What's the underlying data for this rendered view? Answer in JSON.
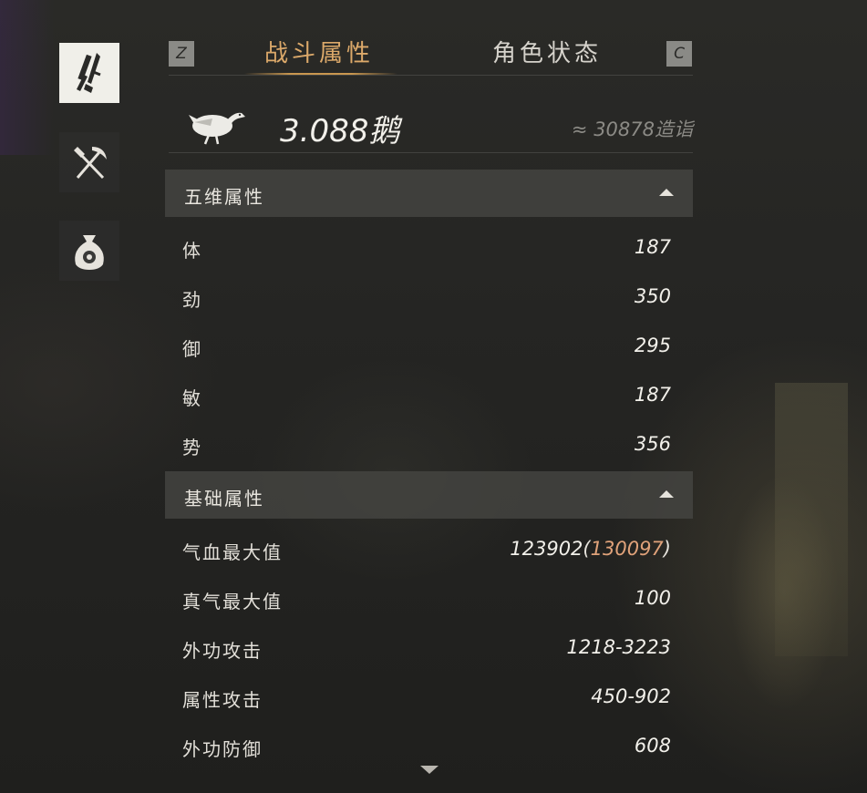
{
  "tabs": {
    "left_key": "Z",
    "right_key": "C",
    "active_label": "战斗属性",
    "inactive_label": "角色状态"
  },
  "sidebar": {
    "items": [
      {
        "icon": "weapons-icon",
        "active": true
      },
      {
        "icon": "shovel-pickaxe-icon",
        "active": false
      },
      {
        "icon": "money-bag-icon",
        "active": false
      }
    ]
  },
  "power": {
    "icon": "goose-icon",
    "value": "3.088鹅",
    "approx": "≈ 30878造诣"
  },
  "sections": {
    "five_dim": {
      "title": "五维属性",
      "rows": [
        {
          "label": "体",
          "value": "187"
        },
        {
          "label": "劲",
          "value": "350"
        },
        {
          "label": "御",
          "value": "295"
        },
        {
          "label": "敏",
          "value": "187"
        },
        {
          "label": "势",
          "value": "356"
        }
      ]
    },
    "basic": {
      "title": "基础属性",
      "hp": {
        "label": "气血最大值",
        "base": "123902",
        "open": "(",
        "bonus": "130097",
        "close": ")"
      },
      "rows": [
        {
          "label": "真气最大值",
          "value": "100"
        },
        {
          "label": "外功攻击",
          "value": "1218-3223"
        },
        {
          "label": "属性攻击",
          "value": "450-902"
        },
        {
          "label": "外功防御",
          "value": "608"
        }
      ]
    }
  },
  "colors": {
    "accent": "#dca96a",
    "bonus": "#e0a27a"
  }
}
